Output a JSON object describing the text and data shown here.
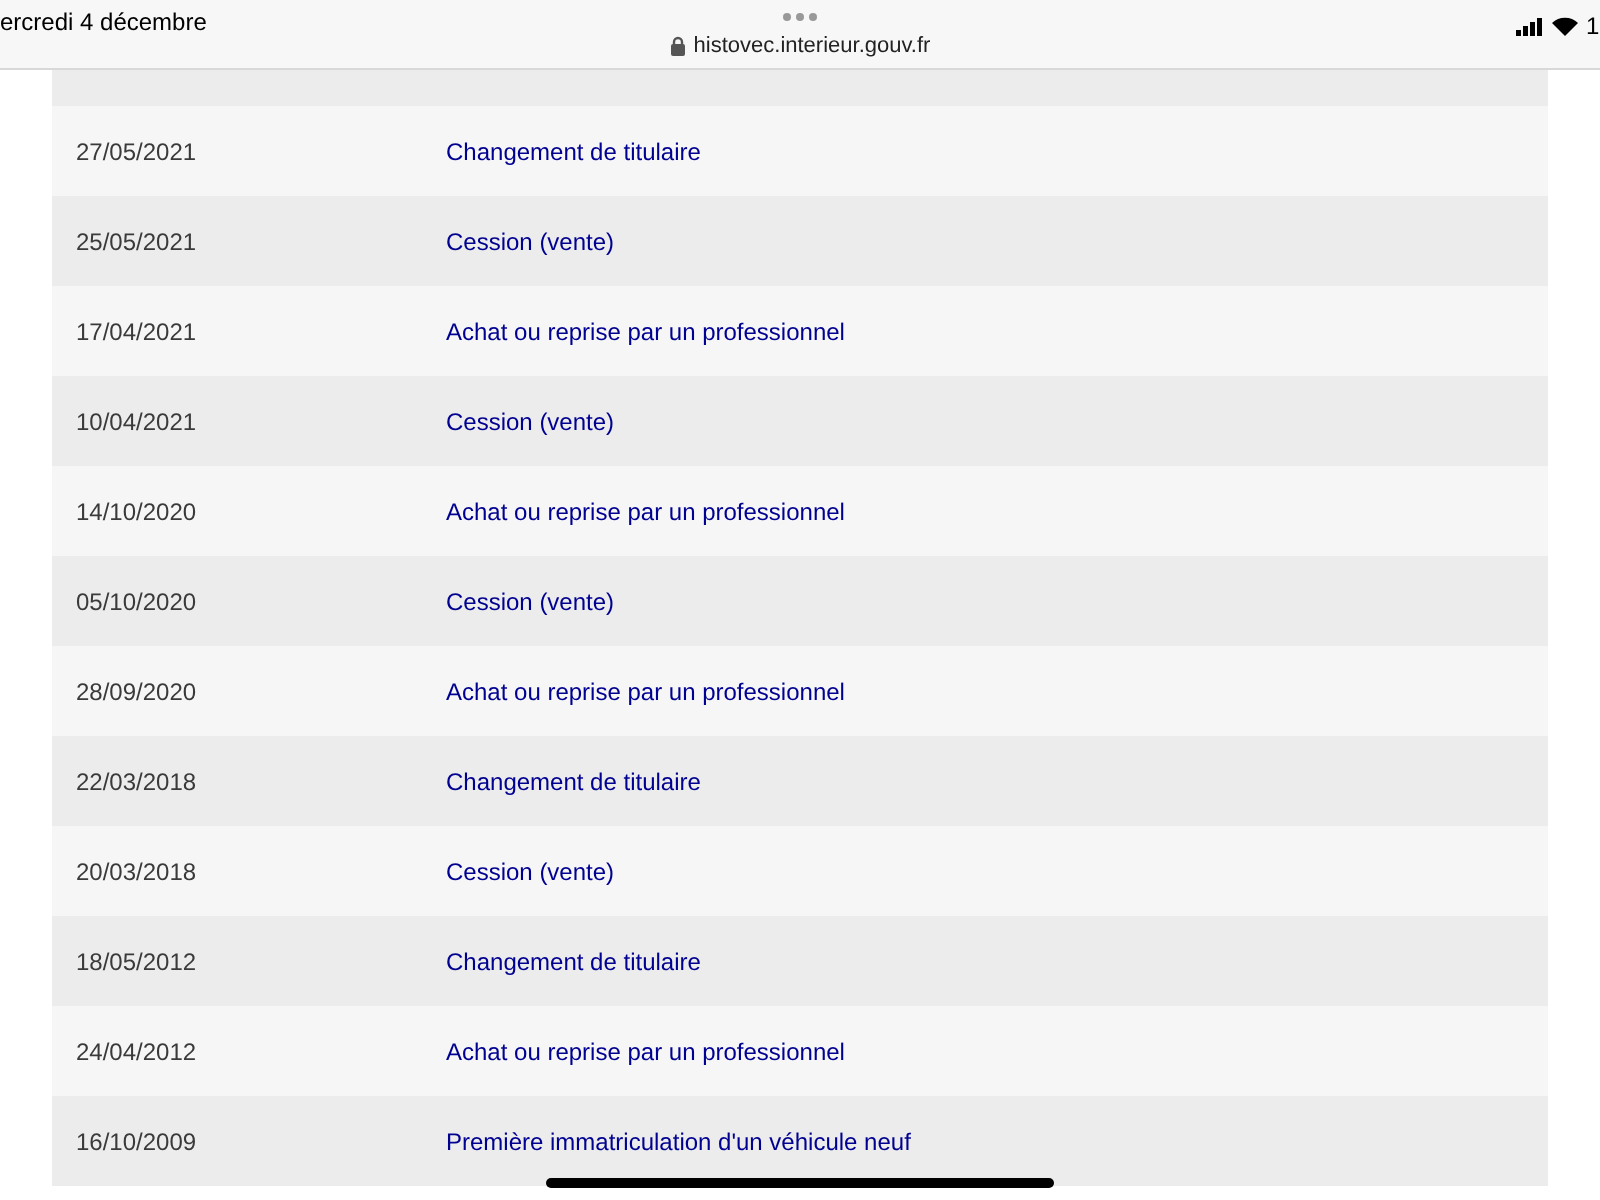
{
  "status_bar": {
    "date": "ercredi 4 décembre",
    "url": "histovec.interieur.gouv.fr",
    "battery": "1"
  },
  "history": {
    "rows": [
      {
        "date": "27/05/2021",
        "event": "Changement de titulaire"
      },
      {
        "date": "25/05/2021",
        "event": "Cession (vente)"
      },
      {
        "date": "17/04/2021",
        "event": "Achat ou reprise par un professionnel"
      },
      {
        "date": "10/04/2021",
        "event": "Cession (vente)"
      },
      {
        "date": "14/10/2020",
        "event": "Achat ou reprise par un professionnel"
      },
      {
        "date": "05/10/2020",
        "event": "Cession (vente)"
      },
      {
        "date": "28/09/2020",
        "event": "Achat ou reprise par un professionnel"
      },
      {
        "date": "22/03/2018",
        "event": "Changement de titulaire"
      },
      {
        "date": "20/03/2018",
        "event": "Cession (vente)"
      },
      {
        "date": "18/05/2012",
        "event": "Changement de titulaire"
      },
      {
        "date": "24/04/2012",
        "event": "Achat ou reprise par un professionnel"
      },
      {
        "date": "16/10/2009",
        "event": "Première immatriculation d'un véhicule neuf"
      }
    ]
  }
}
